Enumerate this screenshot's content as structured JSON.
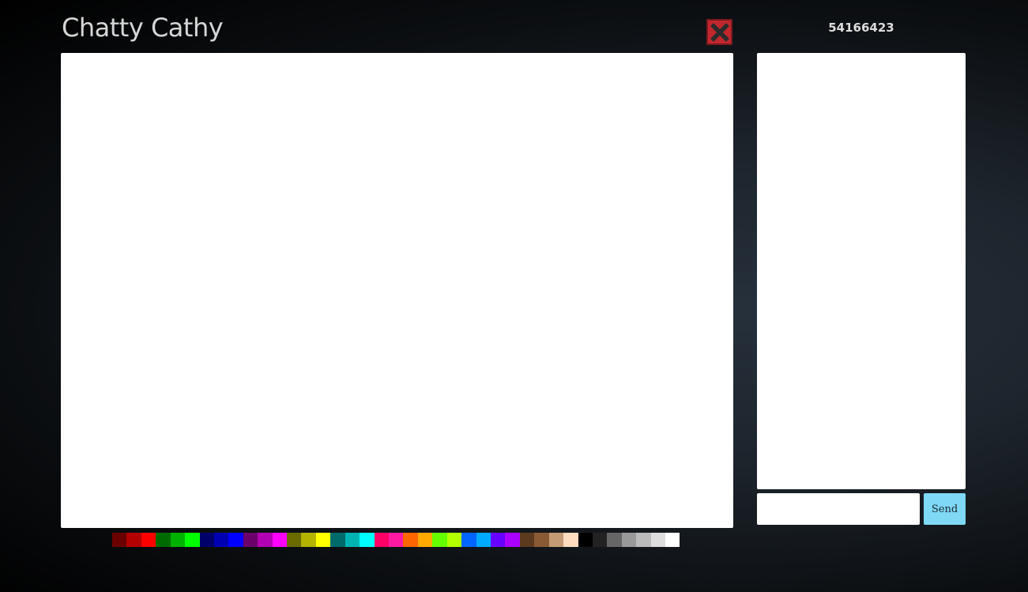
{
  "app": {
    "title": "Chatty Cathy",
    "session_id": "54166423"
  },
  "toolbar": {
    "close_icon": "close-x-icon"
  },
  "chat": {
    "input_value": "",
    "send_label": "Send"
  },
  "palette": [
    "#6b0000",
    "#b30000",
    "#ff0000",
    "#006b00",
    "#00b300",
    "#00ff00",
    "#00006b",
    "#0000b3",
    "#0000ff",
    "#6b006b",
    "#b300b3",
    "#ff00ff",
    "#6b6b00",
    "#b3b300",
    "#ffff00",
    "#006b6b",
    "#00b3b3",
    "#00ffff",
    "#ff0066",
    "#ff1aa3",
    "#ff6600",
    "#ffaa00",
    "#66ff00",
    "#b3ff00",
    "#0066ff",
    "#00aaff",
    "#6600ff",
    "#aa00ff",
    "#5c3a1e",
    "#8a5a35",
    "#c49a74",
    "#ffdcbf",
    "#000000",
    "#222222",
    "#666666",
    "#999999",
    "#bbbbbb",
    "#dddddd",
    "#ffffff"
  ]
}
